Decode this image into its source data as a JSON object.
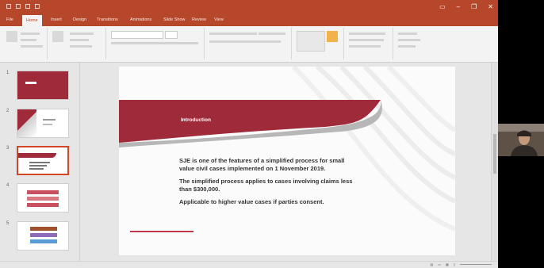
{
  "app": {
    "title": "",
    "tabs": [
      "File",
      "Home",
      "Insert",
      "Design",
      "Transitions",
      "Animations",
      "Slide Show",
      "Review",
      "View"
    ],
    "active_tab": "Home",
    "tell_me": ""
  },
  "colors": {
    "accent": "#b7472a",
    "ribbon": "#f3f3f3",
    "slide_red": "#9e2a3a",
    "slide_gray": "#b0b0b0"
  },
  "thumbnails": [
    {
      "number": "1",
      "selected": false
    },
    {
      "number": "2",
      "selected": false
    },
    {
      "number": "3",
      "selected": true
    },
    {
      "number": "4",
      "selected": false
    },
    {
      "number": "5",
      "selected": false
    }
  ],
  "slide": {
    "title": "Introduction",
    "bullets": [
      "SJE is one of the features of a simplified process for small value civil cases implemented on 1 November 2019.",
      "The simplified process applies to cases involving claims less than $300,000.",
      "Applicable to higher value cases if parties consent."
    ]
  },
  "icons": [
    "save-icon",
    "undo-icon",
    "redo-icon",
    "start-from-beginning-icon",
    "minimize-icon",
    "restore-icon",
    "close-icon"
  ]
}
